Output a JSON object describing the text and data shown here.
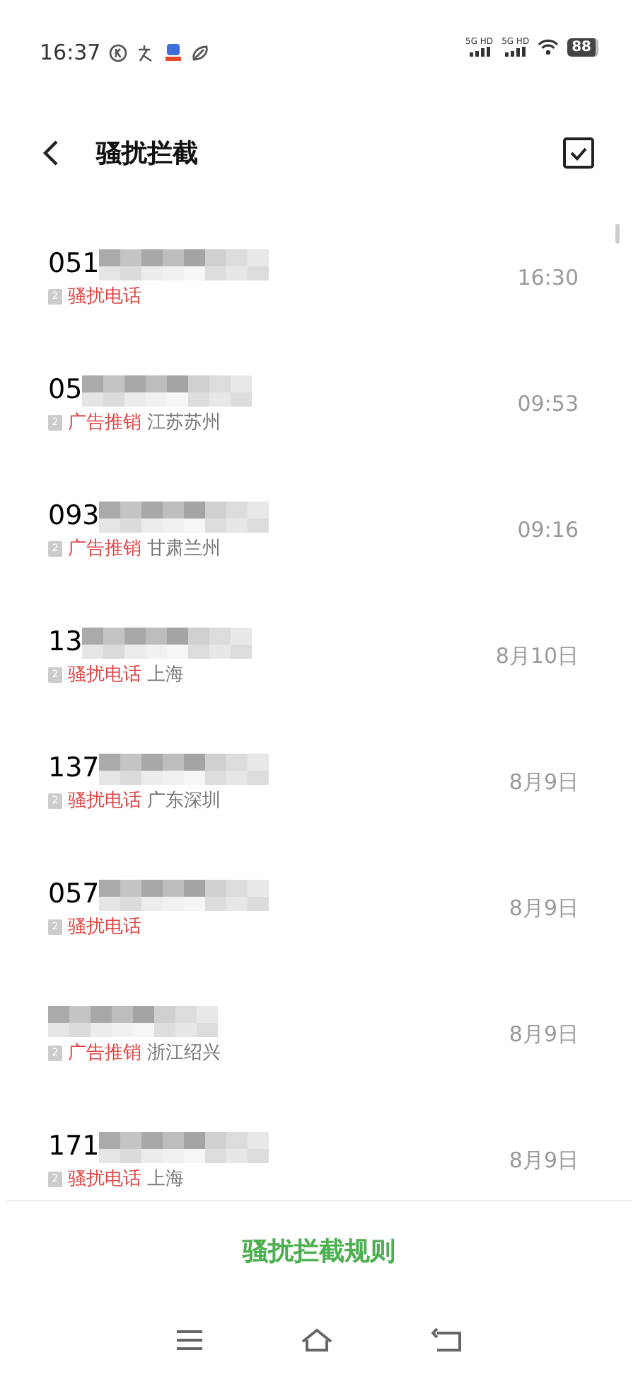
{
  "status_bar": {
    "time": "16:37",
    "battery": "88",
    "signals": [
      "5G HD",
      "5G HD"
    ]
  },
  "header": {
    "title": "骚扰拦截"
  },
  "records": [
    {
      "number": "051",
      "sim": "2",
      "tag": "骚扰电话",
      "time": "16:30"
    },
    {
      "number": "05",
      "sim": "2",
      "tag": "广告推销",
      "location": "江苏苏州",
      "time": "09:53"
    },
    {
      "number": "093",
      "sim": "2",
      "tag": "广告推销",
      "location": "甘肃兰州",
      "time": "09:16"
    },
    {
      "number": "13",
      "sim": "2",
      "tag": "骚扰电话",
      "location": "上海",
      "time": "8月10日"
    },
    {
      "number": "137",
      "sim": "2",
      "tag": "骚扰电话",
      "location": "广东深圳",
      "time": "8月9日"
    },
    {
      "number": "057",
      "sim": "2",
      "tag": "骚扰电话",
      "time": "8月9日"
    },
    {
      "sim": "2",
      "tag": "广告推销",
      "location": "浙江绍兴",
      "time": "8月9日"
    },
    {
      "number": "171",
      "sim": "2",
      "tag": "骚扰电话",
      "location": "上海",
      "time": "8月9日"
    }
  ],
  "footer": {
    "button": "骚扰拦截规则"
  }
}
